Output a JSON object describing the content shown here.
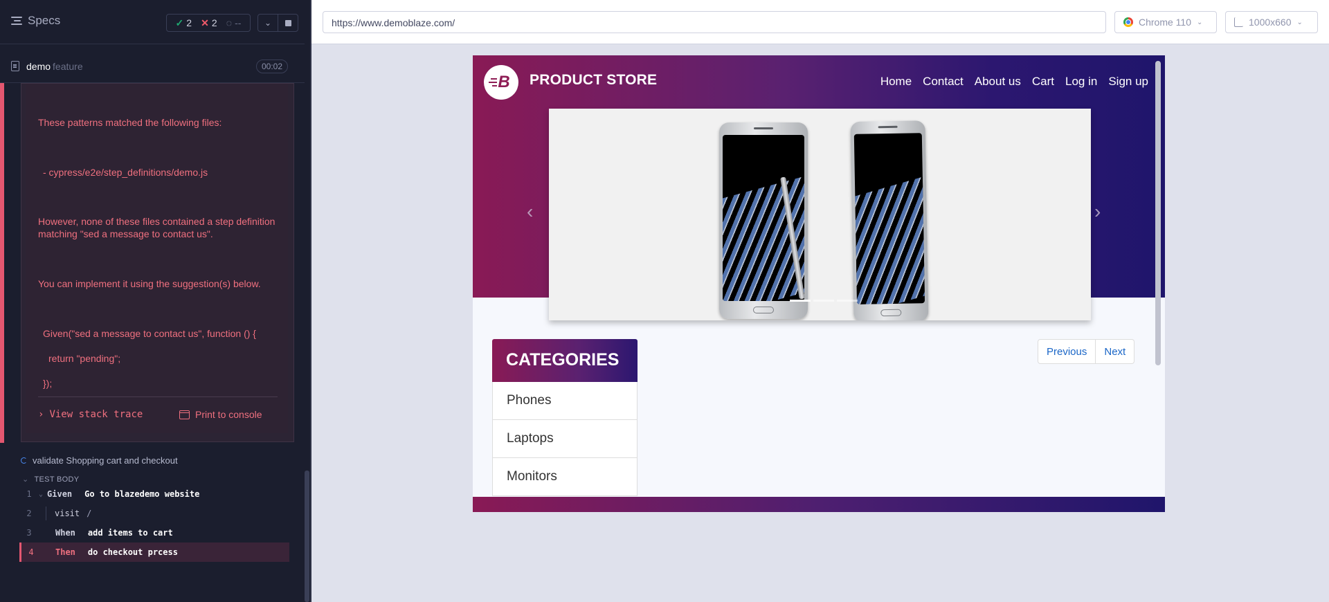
{
  "reporter": {
    "specs_label": "Specs",
    "stats": {
      "passed": "2",
      "failed": "2",
      "pending": "--"
    },
    "spec_file": {
      "name": "demo",
      "ext": "feature",
      "duration": "00:02"
    },
    "error": {
      "line1": "These patterns matched the following files:",
      "line2": "- cypress/e2e/step_definitions/demo.js",
      "line3": "However, none of these files contained a step definition matching \"sed a message to contact us\".",
      "line4": "You can implement it using the suggestion(s) below.",
      "line5": "Given(\"sed a message to contact us\", function () {",
      "line6": "return \"pending\";",
      "line7": "});",
      "stack_trace": "View stack trace",
      "print_console": "Print to console"
    },
    "test2_title": "validate Shopping cart and checkout",
    "test_body_label": "TEST BODY",
    "commands": [
      {
        "num": "1",
        "kw": "Given",
        "arg": "Go to blazedemo website"
      },
      {
        "num": "2",
        "kw": "visit",
        "arg": "/"
      },
      {
        "num": "3",
        "kw": "When",
        "arg": "add items to cart"
      },
      {
        "num": "4",
        "kw": "Then",
        "arg": "do checkout prcess"
      }
    ]
  },
  "aut": {
    "url": "https://www.demoblaze.com/",
    "browser": "Chrome 110",
    "viewport": "1000x660"
  },
  "site": {
    "logo_letter": "B",
    "brand": "PRODUCT STORE",
    "nav": [
      "Home",
      "Contact",
      "About us",
      "Cart",
      "Log in",
      "Sign up"
    ],
    "categories_title": "CATEGORIES",
    "categories": [
      "Phones",
      "Laptops",
      "Monitors"
    ],
    "pager": {
      "previous": "Previous",
      "next": "Next"
    },
    "colors": {
      "brand_start": "#891a55",
      "brand_end": "#1f156b",
      "link": "#1a66c7"
    }
  },
  "icons": [
    "specs-icon",
    "check-icon",
    "x-icon",
    "pending-icon",
    "chevron-down-icon",
    "stop-icon",
    "file-icon",
    "chevron-right-icon",
    "console-icon",
    "chrome-icon",
    "viewport-icon",
    "carousel-prev-icon",
    "carousel-next-icon"
  ]
}
